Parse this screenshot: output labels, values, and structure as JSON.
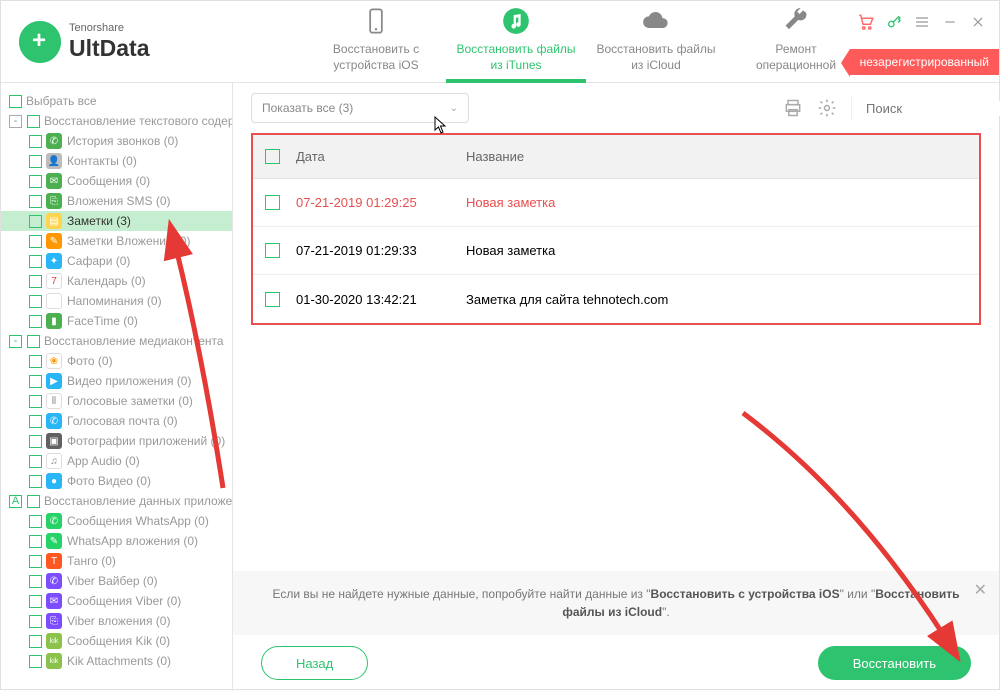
{
  "brand": {
    "small": "Tenorshare",
    "big": "UltData"
  },
  "nav": [
    {
      "label1": "Восстановить с",
      "label2": "устройства iOS"
    },
    {
      "label1": "Восстановить файлы",
      "label2": "из iTunes"
    },
    {
      "label1": "Восстановить файлы",
      "label2": "из iCloud"
    },
    {
      "label1": "Ремонт",
      "label2": "операционной"
    }
  ],
  "badge": "незарегистрированный",
  "sidebar": {
    "select_all": "Выбрать все",
    "groups": [
      {
        "title": "Восстановление текстового содержи",
        "items": [
          {
            "label": "История звонков (0)",
            "color": "#4caf50",
            "glyph": "✆"
          },
          {
            "label": "Контакты (0)",
            "color": "#bdbdbd",
            "glyph": "👤"
          },
          {
            "label": "Сообщения (0)",
            "color": "#4caf50",
            "glyph": "✉"
          },
          {
            "label": "Вложения SMS (0)",
            "color": "#4caf50",
            "glyph": "⎘"
          },
          {
            "label": "Заметки (3)",
            "color": "#ffd54f",
            "glyph": "▤",
            "selected": true
          },
          {
            "label": "Заметки Вложения (0)",
            "color": "#ff9800",
            "glyph": "✎"
          },
          {
            "label": "Сафари (0)",
            "color": "#29b6f6",
            "glyph": "✦"
          },
          {
            "label": "Календарь (0)",
            "color": "#ffffff",
            "glyph": "7",
            "text": "#e53935",
            "border": true
          },
          {
            "label": "Напоминания (0)",
            "color": "#ffffff",
            "glyph": "⦿",
            "border": true
          },
          {
            "label": "FaceTime (0)",
            "color": "#4caf50",
            "glyph": "▮"
          }
        ]
      },
      {
        "title": "Восстановление медиаконтента",
        "expand_color": "green",
        "items": [
          {
            "label": "Фото (0)",
            "color": "#ffffff",
            "glyph": "❀",
            "text": "#ff9800",
            "border": true
          },
          {
            "label": "Видео приложения (0)",
            "color": "#29b6f6",
            "glyph": "▶"
          },
          {
            "label": "Голосовые заметки (0)",
            "color": "#ffffff",
            "glyph": "⫴",
            "text": "#888",
            "border": true
          },
          {
            "label": "Голосовая почта (0)",
            "color": "#29b6f6",
            "glyph": "✆"
          },
          {
            "label": "Фотографии приложений (0)",
            "color": "#616161",
            "glyph": "▣"
          },
          {
            "label": "App Audio (0)",
            "color": "#ffffff",
            "glyph": "♫",
            "text": "#888",
            "border": true
          },
          {
            "label": "Фото Видео (0)",
            "color": "#29b6f6",
            "glyph": "●"
          }
        ]
      },
      {
        "title": "Восстановление данных приложений",
        "expand_char": "A",
        "expand_color": "green",
        "items": [
          {
            "label": "Сообщения WhatsApp (0)",
            "color": "#25d366",
            "glyph": "✆"
          },
          {
            "label": "WhatsApp вложения (0)",
            "color": "#25d366",
            "glyph": "✎"
          },
          {
            "label": "Танго (0)",
            "color": "#ff5722",
            "glyph": "T"
          },
          {
            "label": "Viber Вайбер (0)",
            "color": "#7c4dff",
            "glyph": "✆"
          },
          {
            "label": "Сообщения Viber (0)",
            "color": "#7c4dff",
            "glyph": "✉"
          },
          {
            "label": "Viber вложения (0)",
            "color": "#7c4dff",
            "glyph": "⎘"
          },
          {
            "label": "Сообщения Kik (0)",
            "color": "#8bc34a",
            "glyph": "kik"
          },
          {
            "label": "Kik Attachments (0)",
            "color": "#8bc34a",
            "glyph": "kik"
          }
        ]
      }
    ]
  },
  "toolbar": {
    "dropdown": "Показать все  (3)",
    "search_placeholder": "Поиск"
  },
  "table": {
    "headers": {
      "date": "Дата",
      "title": "Название"
    },
    "rows": [
      {
        "date": "07-21-2019 01:29:25",
        "title": "Новая заметка",
        "deleted": true
      },
      {
        "date": "07-21-2019 01:29:33",
        "title": "Новая заметка",
        "deleted": false
      },
      {
        "date": "01-30-2020 13:42:21",
        "title": "Заметка для сайта tehnotech.com",
        "deleted": false
      }
    ]
  },
  "hint": {
    "p1": "Если вы не найдете нужные данные, попробуйте найти данные из \"",
    "b1": "Восстановить с устройства iOS",
    "p2": "\" или \"",
    "b2": "Восстановить файлы из iCloud",
    "p3": "\"."
  },
  "buttons": {
    "back": "Назад",
    "restore": "Восстановить"
  }
}
